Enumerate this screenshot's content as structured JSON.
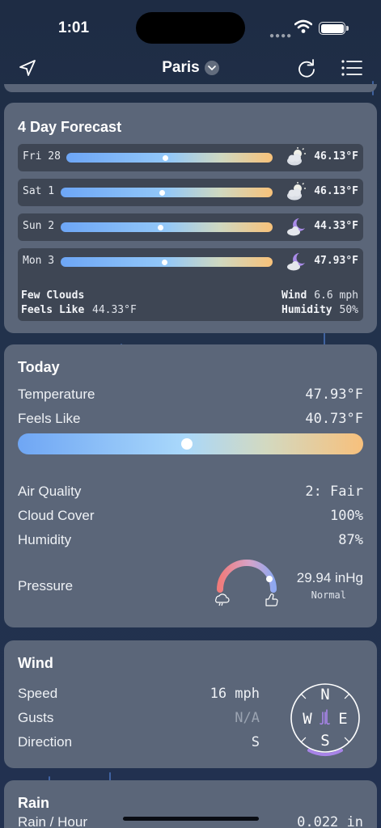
{
  "status_bar": {
    "time": "1:01"
  },
  "nav": {
    "city": "Paris"
  },
  "forecast": {
    "title": "4 Day Forecast",
    "days": [
      {
        "day": "Fri 28",
        "temp": "46.13°F",
        "icon": "cloud-sun-icon",
        "marker": 0.48
      },
      {
        "day": "Sat 1",
        "temp": "46.13°F",
        "icon": "cloud-sun-icon",
        "marker": 0.48
      },
      {
        "day": "Sun 2",
        "temp": "44.33°F",
        "icon": "cloud-moon-icon",
        "marker": 0.47
      },
      {
        "day": "Mon 3",
        "temp": "47.93°F",
        "icon": "cloud-moon-icon",
        "marker": 0.49
      }
    ],
    "details": {
      "condition": "Few Clouds",
      "feels_like_label": "Feels Like",
      "feels_like_value": "44.33°F",
      "wind_label": "Wind",
      "wind_value": "6.6 mph",
      "humidity_label": "Humidity",
      "humidity_value": "50%"
    }
  },
  "today": {
    "title": "Today",
    "temperature_label": "Temperature",
    "temperature_value": "47.93°F",
    "feels_like_label": "Feels Like",
    "feels_like_value": "40.73°F",
    "temp_marker": 0.49,
    "air_quality_label": "Air Quality",
    "air_quality_value": "2: Fair",
    "cloud_cover_label": "Cloud Cover",
    "cloud_cover_value": "100%",
    "humidity_label": "Humidity",
    "humidity_value": "87%",
    "pressure_label": "Pressure",
    "pressure_value": "29.94 inHg",
    "pressure_status": "Normal"
  },
  "wind": {
    "title": "Wind",
    "speed_label": "Speed",
    "speed_value": "16 mph",
    "gusts_label": "Gusts",
    "gusts_value": "N/A",
    "direction_label": "Direction",
    "direction_value": "S",
    "compass": {
      "n": "N",
      "e": "E",
      "s": "S",
      "w": "W"
    }
  },
  "rain": {
    "title": "Rain",
    "per_hour_label": "Rain / Hour",
    "per_hour_value": "0.022 in"
  },
  "colors": {
    "background": "#1e2c44",
    "card": "#5b6679",
    "row": "#3e4654",
    "bar_cold": "#6da6f6",
    "bar_warm": "#f8c27a"
  }
}
